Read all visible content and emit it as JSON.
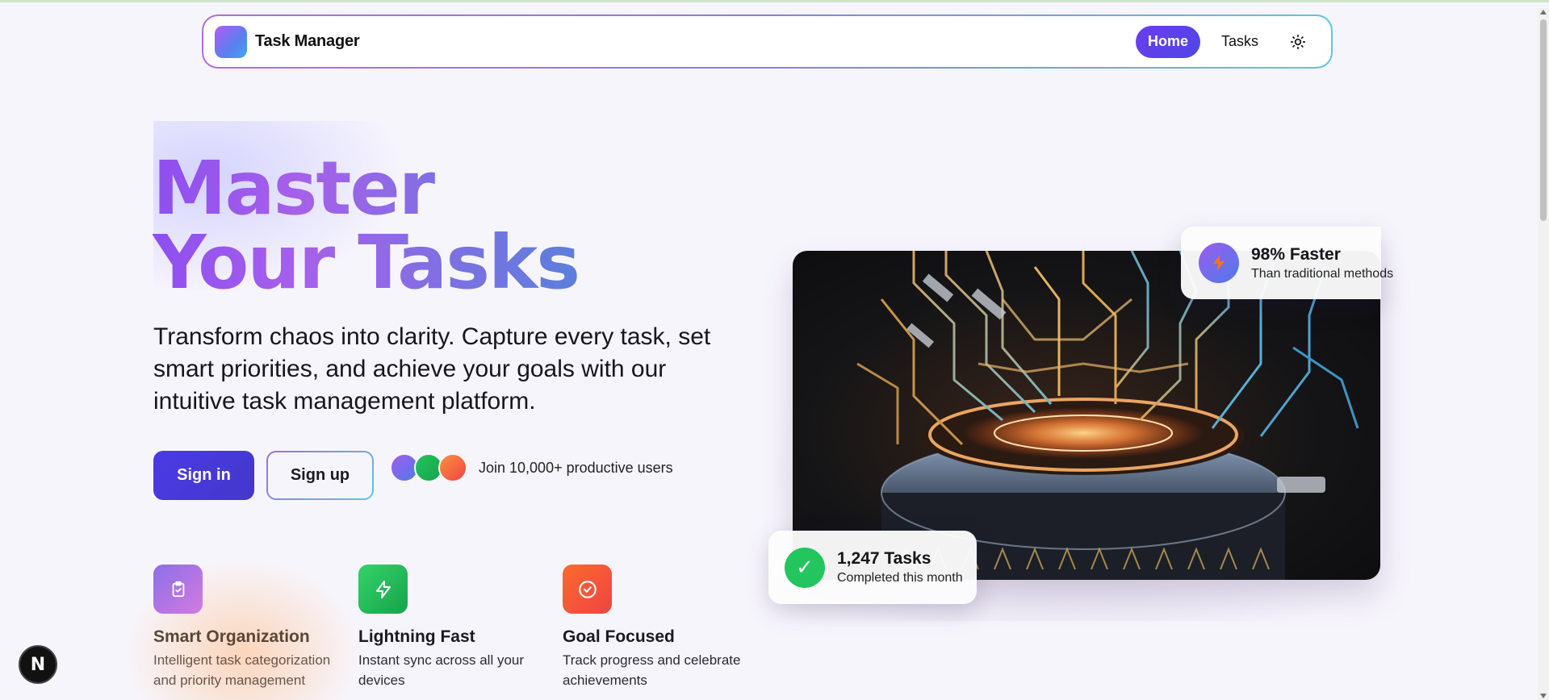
{
  "nav": {
    "brand": "Task Manager",
    "links": [
      {
        "label": "Home",
        "active": true
      },
      {
        "label": "Tasks",
        "active": false
      }
    ],
    "theme_icon": "sun-icon"
  },
  "hero": {
    "title_line1": "Master",
    "title_line2": "Your Tasks",
    "subtitle": "Transform chaos into clarity. Capture every task, set smart priorities, and achieve your goals with our intuitive task management platform.",
    "signin_label": "Sign in",
    "signup_label": "Sign up",
    "social_proof": "Join 10,000+ productive users"
  },
  "features": [
    {
      "icon": "clipboard-check-icon",
      "title": "Smart Organization",
      "description": "Intelligent task categorization and priority management"
    },
    {
      "icon": "lightning-icon",
      "title": "Lightning Fast",
      "description": "Instant sync across all your devices"
    },
    {
      "icon": "target-check-icon",
      "title": "Goal Focused",
      "description": "Track progress and celebrate achievements"
    }
  ],
  "stats": {
    "speed": {
      "title": "98% Faster",
      "subtitle": "Than traditional methods",
      "icon": "lightning-icon"
    },
    "tasks": {
      "title": "1,247 Tasks",
      "subtitle": "Completed this month",
      "icon": "checkmark-icon",
      "check_glyph": "✓"
    }
  },
  "dev_badge": {
    "label": "N",
    "icon": "nextjs-icon"
  },
  "colors": {
    "accent": "#4f46e5",
    "title_gradient_start": "#8e4ff0",
    "title_gradient_end": "#5a7fdc",
    "success": "#22c55e"
  }
}
